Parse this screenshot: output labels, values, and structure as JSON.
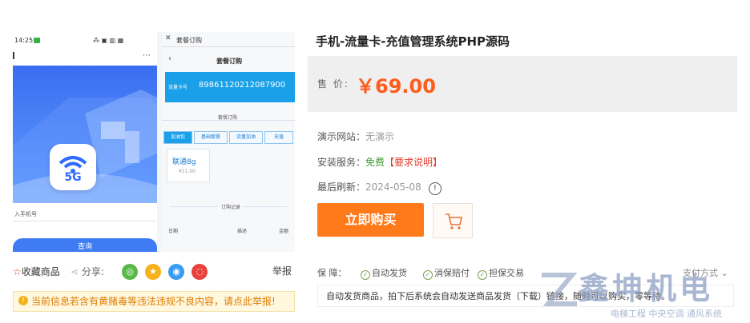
{
  "product": {
    "title": "手机-流量卡-充值管理系统PHP源码",
    "price_label": "售 价:",
    "price": "￥69.00"
  },
  "info": {
    "demo_label": "演示网站：",
    "demo_value": "无演示",
    "install_label": "安装服务：",
    "install_value": "免费",
    "install_link": "【要求说明】",
    "refresh_label": "最后刷新：",
    "refresh_value": "2024-05-08"
  },
  "actions": {
    "buy_label": "立即购买"
  },
  "guarantee": {
    "label": "保 障：",
    "items": [
      "自动发货",
      "消保赔付",
      "担保交易"
    ],
    "pay_method": "支付方式"
  },
  "note": "自动发货商品，拍下后系统会自动发送商品发货（下载）链接，随时可以购买，零等待。",
  "left_actions": {
    "favorite": "收藏商品",
    "share": "分享:",
    "report": "举报"
  },
  "warning": "当前信息若含有黄赌毒等违法违规不良内容，请点此举报!",
  "screens": {
    "p1_time": "14:25",
    "p1_signal": "⁂ ▣ ▥ ▦",
    "p1_badge": "5G",
    "p1_input": "入手机号",
    "p1_button": "查询",
    "p2_header": "套餐订购",
    "p2_title": "套餐订购",
    "p2_card_label": "流量卡号",
    "p2_card_number": "89861120212087900",
    "p2_sub_title": "套餐订购",
    "p2_tabs": [
      "加油包",
      "基础套餐",
      "流量加油",
      "充值"
    ],
    "p2_product_name": "联通8g",
    "p2_product_price": "¥11.00",
    "p2_records": "订购记录",
    "p2_cols": [
      "日期",
      "描述",
      "金额"
    ]
  },
  "watermark": {
    "name": "鑫坤机电",
    "sub": "电梯工程  中央空调  通风系统"
  },
  "colors": {
    "accent": "#ff7a1a",
    "price": "#ff5b1a",
    "free": "#3c9a2f",
    "link": "#e23c2c"
  }
}
